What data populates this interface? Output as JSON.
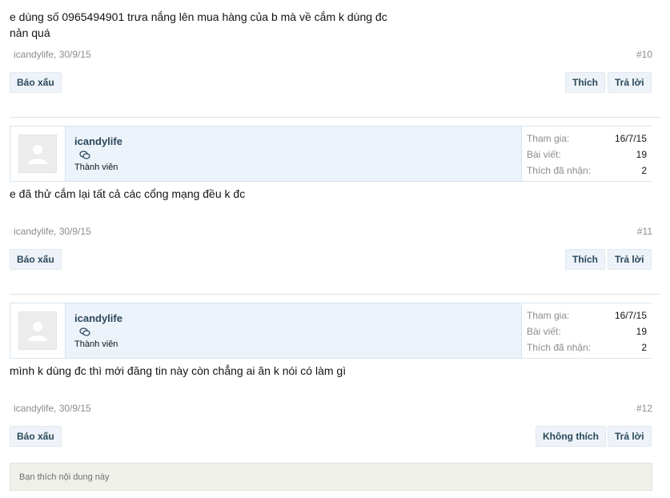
{
  "posts": [
    {
      "text_line1": "e dùng số 0965494901 trưa nắng lên mua hàng của b mà về cắm k dùng đc",
      "text_line2": "nản quá",
      "meta": "icandylife, 30/9/15",
      "num": "#10",
      "report": "Báo xấu",
      "like": "Thích",
      "reply": "Trả lời"
    },
    {
      "user": {
        "name": "icandylife",
        "role": "Thành viên"
      },
      "stats": [
        {
          "k": "Tham gia:",
          "v": "16/7/15"
        },
        {
          "k": "Bài viết:",
          "v": "19"
        },
        {
          "k": "Thích đã nhận:",
          "v": "2"
        }
      ],
      "text_line1": "e đã thử cắm lại tất cả các cổng mạng đều k đc",
      "meta": "icandylife, 30/9/15",
      "num": "#11",
      "report": "Báo xấu",
      "like": "Thích",
      "reply": "Trả lời"
    },
    {
      "user": {
        "name": "icandylife",
        "role": "Thành viên"
      },
      "stats": [
        {
          "k": "Tham gia:",
          "v": "16/7/15"
        },
        {
          "k": "Bài viết:",
          "v": "19"
        },
        {
          "k": "Thích đã nhận:",
          "v": "2"
        }
      ],
      "text_line1": "mình k dùng đc thì mới đăng tin này còn chẳng ai ăn k nói có làm gì",
      "meta": "icandylife, 30/9/15",
      "num": "#12",
      "report": "Báo xấu",
      "like": "Không thích",
      "reply": "Trả lời"
    }
  ],
  "like_box": "Bạn thích nội dung này",
  "icons": {
    "avatar": "default-avatar-icon",
    "chat": "chat-bubbles-icon"
  },
  "colors": {
    "accent": "#2b485c",
    "button_bg": "#edf3f8",
    "card_bg": "#edf3fb"
  }
}
